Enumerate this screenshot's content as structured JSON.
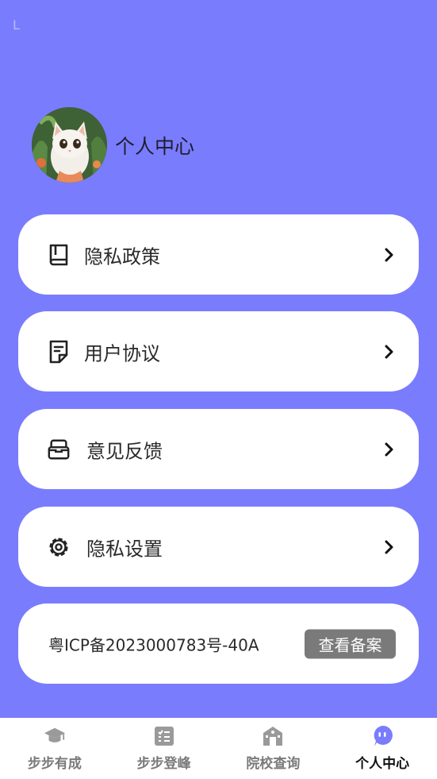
{
  "status_bar": {
    "glyph": "L"
  },
  "profile": {
    "title": "个人中心",
    "avatar_icon": "cat-avatar"
  },
  "menu": [
    {
      "label": "隐私政策",
      "icon": "book-icon"
    },
    {
      "label": "用户协议",
      "icon": "document-icon"
    },
    {
      "label": "意见反馈",
      "icon": "inbox-icon"
    },
    {
      "label": "隐私设置",
      "icon": "gear-icon"
    }
  ],
  "icp": {
    "text": "粤ICP备2023000783号-40A",
    "button_label": "查看备案"
  },
  "tabbar": [
    {
      "label": "步步有成",
      "icon": "graduation-cap-icon",
      "active": false
    },
    {
      "label": "步步登峰",
      "icon": "checklist-icon",
      "active": false
    },
    {
      "label": "院校查询",
      "icon": "school-building-icon",
      "active": false
    },
    {
      "label": "个人中心",
      "icon": "chat-bot-icon",
      "active": true
    }
  ],
  "colors": {
    "background": "#7a7cfe",
    "active_tab": "#111111",
    "inactive_tab": "#7a7a7a",
    "accent_icon": "#7a7cfe"
  }
}
